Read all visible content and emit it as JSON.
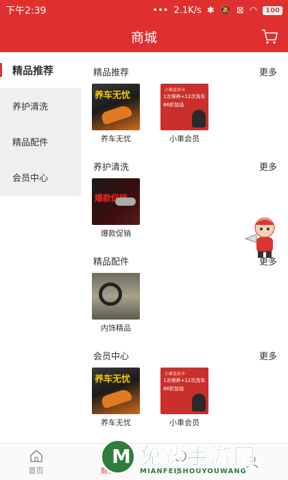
{
  "statusbar": {
    "time": "下午2:39",
    "dots": "•••",
    "speed": "2.1K/s",
    "battery": "100"
  },
  "header": {
    "title": "商城"
  },
  "sidebar": {
    "items": [
      {
        "label": "精品推荐",
        "active": true
      },
      {
        "label": "养护清洗",
        "active": false
      },
      {
        "label": "精品配件",
        "active": false
      },
      {
        "label": "会员中心",
        "active": false
      }
    ]
  },
  "sections": [
    {
      "title": "精品推荐",
      "more": "更多",
      "products": [
        {
          "name": "养车无忧",
          "thumb_text": "养车无忧",
          "thumb_icon": "car-promo-image"
        },
        {
          "name": "小車会员",
          "thumb_icon": "member-card-image"
        }
      ]
    },
    {
      "title": "养护清洗",
      "more": "更多",
      "products": [
        {
          "name": "爆款促销",
          "thumb_text": "爆款促销",
          "thumb_icon": "headlight-promo-image"
        }
      ]
    },
    {
      "title": "精品配件",
      "more": "更多",
      "products": [
        {
          "name": "内饰精品",
          "thumb_icon": "steering-wheel-image"
        }
      ]
    },
    {
      "title": "会员中心",
      "more": "更多",
      "products": [
        {
          "name": "养车无忧",
          "thumb_text": "养车无忧",
          "thumb_icon": "car-promo-image"
        },
        {
          "name": "小車会员",
          "thumb_icon": "member-card-image"
        }
      ]
    }
  ],
  "card_text": {
    "line1": "小車会员卡",
    "line2": "1次保养+12次洗车",
    "line3": "86折加油"
  },
  "tabbar": {
    "items": [
      {
        "label": "首页",
        "icon": "home-icon",
        "active": false
      },
      {
        "label": "商城",
        "icon": "shop-icon",
        "active": true
      },
      {
        "label": "小",
        "icon": "service-icon",
        "active": false
      },
      {
        "label": "",
        "icon": "profile-icon",
        "active": false
      }
    ]
  },
  "watermark": {
    "big": "免费手游网",
    "small": "MIANFEISHOUYOUWANG"
  },
  "colors": {
    "brand": "#e02f2f",
    "watermark": "#2e7d3a"
  }
}
